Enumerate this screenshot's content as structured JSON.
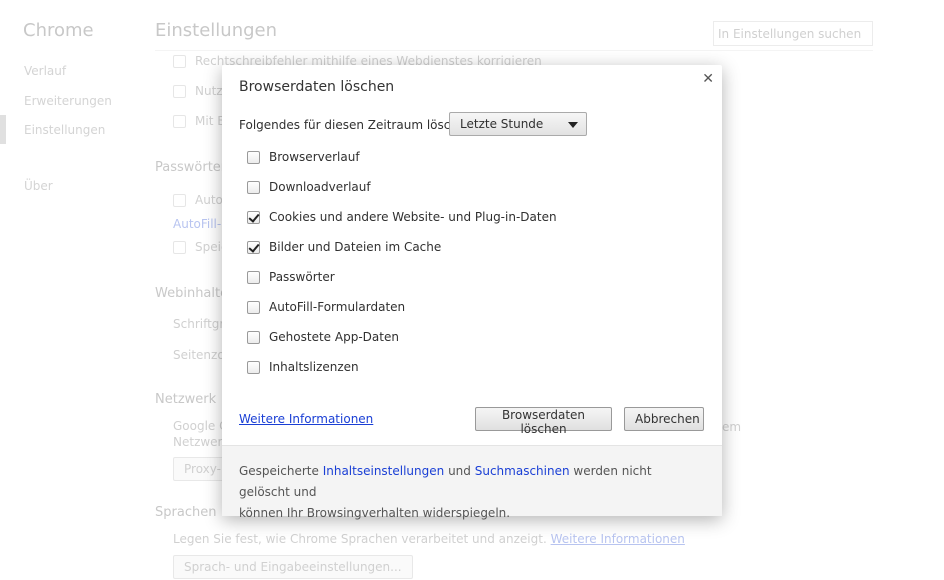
{
  "background": {
    "app_title": "Chrome",
    "page_title": "Einstellungen",
    "search_placeholder": "In Einstellungen suchen",
    "nav": [
      {
        "label": "Verlauf"
      },
      {
        "label": "Erweiterungen"
      },
      {
        "label": "Einstellungen",
        "active": true
      },
      {
        "label": "Über"
      }
    ],
    "rows": [
      "Rechtschreibfehler mithilfe eines Webdienstes korrigieren",
      "Nutz",
      "Mit B"
    ],
    "sections": {
      "passwords": "Passwörter",
      "passwords_row1": "Autof",
      "passwords_link": "AutoFill-E",
      "passwords_row2": "Speic",
      "web": "Webinhalte",
      "web_row1": "Schriftgrö",
      "web_row2": "Seitenzoo",
      "network": "Netzwerk",
      "network_text1": "Google C",
      "network_text2": "Netzwerk",
      "network_text_end": "em",
      "proxy_button": "Proxy-E",
      "languages": "Sprachen",
      "languages_text": "Legen Sie fest, wie Chrome Sprachen verarbeitet und anzeigt.",
      "languages_link": "Weitere Informationen",
      "languages_button": "Sprach- und Eingabeeinstellungen..."
    }
  },
  "dialog": {
    "title": "Browserdaten löschen",
    "close_icon": "close-icon",
    "period_label": "Folgendes für diesen Zeitraum löschen:",
    "period_value": "Letzte Stunde",
    "items": [
      {
        "label": "Browserverlauf",
        "checked": false
      },
      {
        "label": "Downloadverlauf",
        "checked": false
      },
      {
        "label": "Cookies und andere Website- und Plug-in-Daten",
        "checked": true
      },
      {
        "label": "Bilder und Dateien im Cache",
        "checked": true
      },
      {
        "label": "Passwörter",
        "checked": false
      },
      {
        "label": "AutoFill-Formulardaten",
        "checked": false
      },
      {
        "label": "Gehostete App-Daten",
        "checked": false
      },
      {
        "label": "Inhaltslizenzen",
        "checked": false
      }
    ],
    "more_info": "Weitere Informationen",
    "confirm_button": "Browserdaten löschen",
    "cancel_button": "Abbrechen",
    "footer": {
      "t1": "Gespeicherte ",
      "link1": "Inhaltseinstellungen",
      "t2": " und ",
      "link2": "Suchmaschinen",
      "t3": " werden nicht gelöscht und",
      "t4": "können Ihr Browsingverhalten widerspiegeln."
    }
  }
}
